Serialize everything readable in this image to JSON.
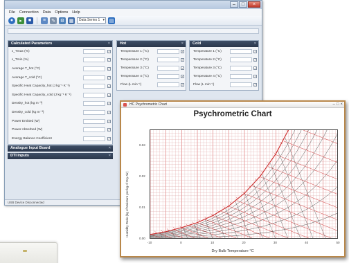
{
  "window": {
    "menu": [
      "File",
      "Connection",
      "Data",
      "Options",
      "Help"
    ],
    "toolbar": {
      "icons": [
        "connect-icon",
        "open-icon",
        "save-icon",
        "table-icon",
        "settings-icon",
        "settings-icon",
        "grid-icon",
        "chart-icon"
      ],
      "dropdown_value": "Data Series 1"
    },
    "status": "USB Device Disconnected"
  },
  "calculated": {
    "title": "Calculated Parameters",
    "rows": [
      "ε_Tmax (%)",
      "ε_Tmin (%)",
      "Average T_hot (°C)",
      "Average T_cold (°C)",
      "Specific Heat Capacity_hot (J kg⁻¹ K⁻¹)",
      "Specific Heat Capacity_cold (J kg⁻¹ K⁻¹)",
      "Density_hot (kg m⁻³)",
      "Density_cold (kg m⁻³)",
      "Power Emitted (W)",
      "Power Absorbed (W)",
      "Energy Balance Coefficient"
    ]
  },
  "hot": {
    "title": "Hot",
    "rows": [
      "Temperature 1 (°C)",
      "Temperature 2 (°C)",
      "Temperature 3 (°C)",
      "Temperature 4 (°C)",
      "Flow (L min⁻¹)"
    ]
  },
  "cold": {
    "title": "Cold",
    "rows": [
      "Temperature 1 (°C)",
      "Temperature 2 (°C)",
      "Temperature 3 (°C)",
      "Temperature 4 (°C)",
      "Flow (L min⁻¹)"
    ]
  },
  "collapsed_panels": [
    "Analogue Input Board",
    "DTI Inputs"
  ],
  "chart_window": {
    "window_title": "HC Psychrometric Chart",
    "accent": "#b8874a"
  },
  "chart_data": {
    "type": "line",
    "title": "Psychrometric Chart",
    "xlabel": "Dry Bulb Temperature °C",
    "ylabel": "Humidity Ratio (kg of Moisture per kg of Dry Air)",
    "xlim": [
      -10,
      50
    ],
    "ylim": [
      0,
      0.035
    ],
    "x_ticks": [
      -10,
      0,
      10,
      20,
      30,
      40,
      50
    ],
    "y_ticks": [
      0,
      0.01,
      0.02,
      0.03
    ],
    "saturation_curve": {
      "x": [
        -10,
        -5,
        0,
        5,
        10,
        15,
        20,
        25,
        30,
        35,
        40
      ],
      "y": [
        0.0016,
        0.0025,
        0.0038,
        0.0054,
        0.0077,
        0.0107,
        0.0148,
        0.0202,
        0.0274,
        0.0369,
        0.0491
      ]
    },
    "series": [
      {
        "name": "saturation",
        "color": "#cc2a2a"
      },
      {
        "name": "relative humidity",
        "color": "#555555"
      },
      {
        "name": "wet bulb",
        "color": "#cc2a2a"
      }
    ],
    "grid": true
  }
}
